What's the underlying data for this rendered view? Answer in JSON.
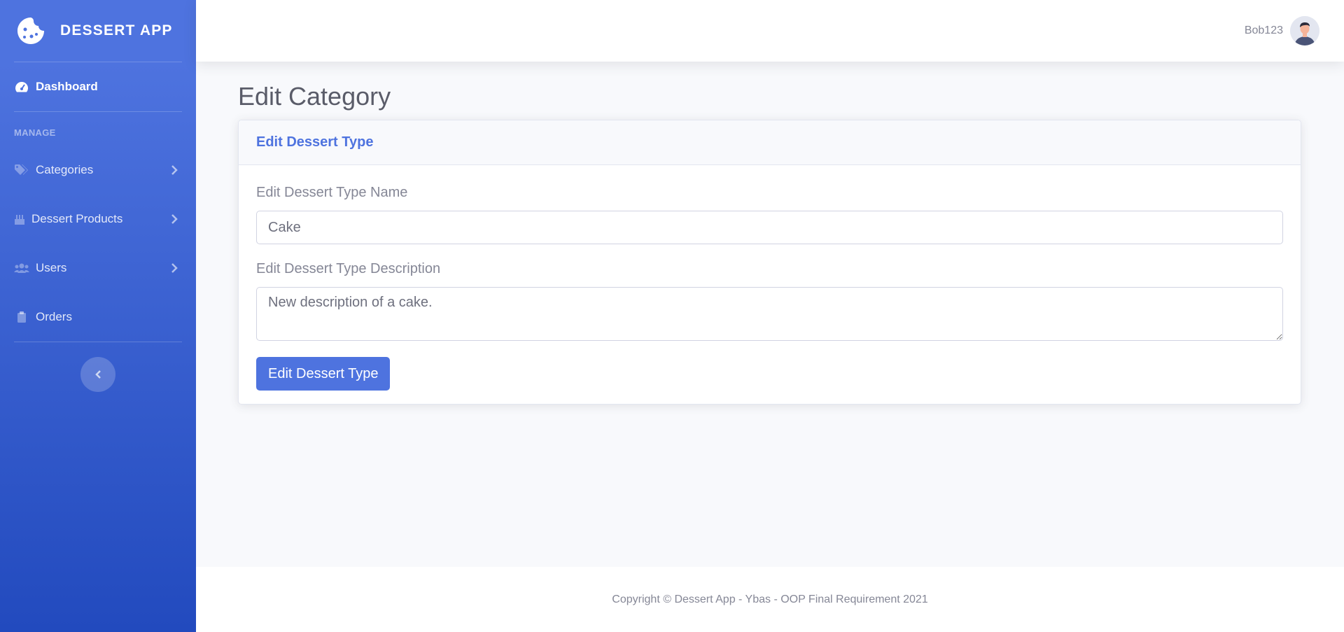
{
  "sidebar": {
    "brand": "DESSERT APP",
    "brand_icon": "cookie-icon",
    "dashboard": {
      "label": "Dashboard",
      "icon": "tachometer-icon"
    },
    "heading": "MANAGE",
    "items": [
      {
        "label": "Categories",
        "icon": "tags-icon"
      },
      {
        "label": "Dessert Products",
        "icon": "birthday-cake-icon"
      },
      {
        "label": "Users",
        "icon": "users-icon"
      },
      {
        "label": "Orders",
        "icon": "clipboard-icon"
      }
    ]
  },
  "topbar": {
    "username": "Bob123"
  },
  "page": {
    "title": "Edit Category"
  },
  "card": {
    "title": "Edit Dessert Type",
    "name_label": "Edit Dessert Type Name",
    "name_value": "Cake",
    "description_label": "Edit Dessert Type Description",
    "description_value": "New description of a cake.",
    "submit_label": "Edit Dessert Type"
  },
  "footer": {
    "copyright": "Copyright © Dessert App - Ybas - OOP Final Requirement 2021"
  },
  "colors": {
    "primary": "#4e73df",
    "gradient_end": "#224abe",
    "background": "#f8f9fc"
  }
}
